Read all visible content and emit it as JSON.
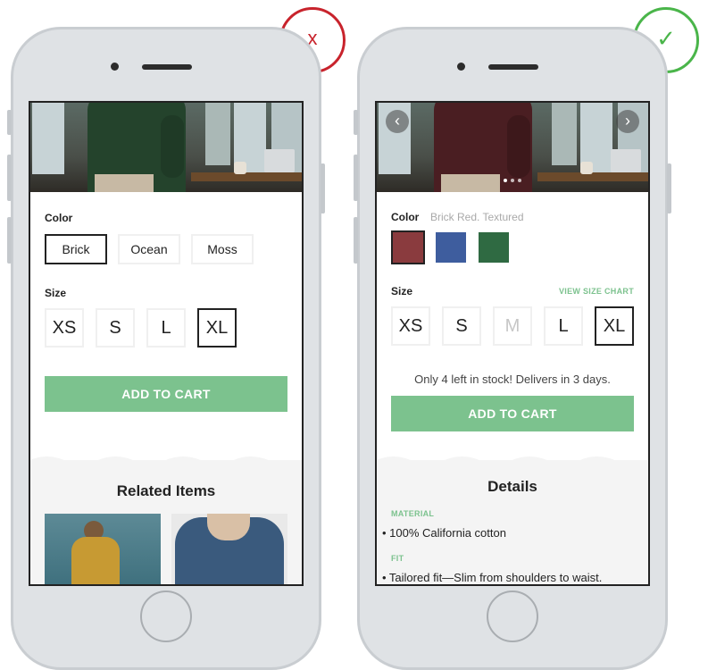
{
  "badges": {
    "bad": {
      "symbol": "x",
      "color": "#c8232c"
    },
    "good": {
      "symbol": "✓",
      "color": "#4ab54a"
    }
  },
  "left_phone": {
    "color_label": "Color",
    "colors": [
      "Brick",
      "Ocean",
      "Moss"
    ],
    "selected_color": "Brick",
    "size_label": "Size",
    "sizes": [
      "XS",
      "S",
      "L",
      "XL"
    ],
    "selected_size": "XL",
    "add_to_cart": "ADD TO CART",
    "related_title": "Related Items"
  },
  "right_phone": {
    "color_label": "Color",
    "color_value": "Brick Red. Textured",
    "swatches": [
      {
        "name": "brick",
        "color": "#8a3b3e"
      },
      {
        "name": "ocean",
        "color": "#3e5d9e"
      },
      {
        "name": "moss",
        "color": "#2f6a42"
      }
    ],
    "size_label": "Size",
    "size_chart_link": "VIEW SIZE CHART",
    "sizes": [
      "XS",
      "S",
      "M",
      "L",
      "XL"
    ],
    "disabled_size": "M",
    "selected_size": "XL",
    "stock_text": "Only 4 left in stock! Delivers in 3 days.",
    "add_to_cart": "ADD TO CART",
    "details_title": "Details",
    "material_label": "MATERIAL",
    "material_value": "• 100% California cotton",
    "fit_label": "FIT",
    "fit_value": "• Tailored fit—Slim from shoulders to waist."
  },
  "colors": {
    "accent_green": "#7cc28e",
    "shirt_left": "#24432c",
    "shirt_right": "#4a1e22"
  }
}
